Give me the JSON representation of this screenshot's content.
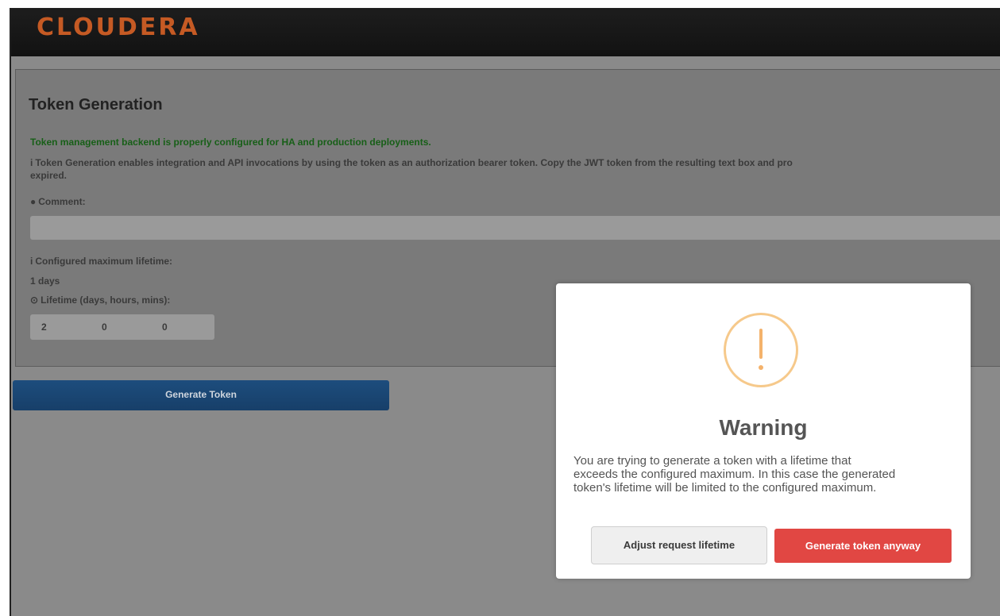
{
  "header": {
    "logo": "CLOUDERA"
  },
  "page": {
    "title": "Token Generation",
    "status_message": "Token management backend is properly configured for HA and production deployments.",
    "info_line1": "Token Generation enables integration and API invocations by using the token as an authorization bearer token. Copy the JWT token from the resulting text box and pro",
    "info_line2": "expired.",
    "comment_label": "Comment:",
    "comment_value": "",
    "max_lifetime_label": "Configured maximum lifetime:",
    "max_lifetime_value": "1 days",
    "lifetime_label": "Lifetime (days, hours, mins):",
    "lifetime": {
      "days": "2",
      "hours": "0",
      "mins": "0"
    },
    "generate_button": "Generate Token"
  },
  "icons": {
    "info": "info-icon",
    "comment": "speech-bubble-icon",
    "clock": "clock-icon",
    "warning": "warning-exclamation-icon"
  },
  "modal": {
    "title": "Warning",
    "body_line1": "You are trying to generate a token with a lifetime that",
    "body_line2": "exceeds the configured maximum. In this case the generated",
    "body_line3": "token's lifetime will be limited to the configured maximum.",
    "adjust_button": "Adjust request lifetime",
    "confirm_button": "Generate token anyway"
  },
  "colors": {
    "logo": "#c55a24",
    "status_ok": "#175f17",
    "primary_button": "#1d4d7d",
    "danger_button": "#e14743",
    "warning_icon": "#f4b26b"
  }
}
